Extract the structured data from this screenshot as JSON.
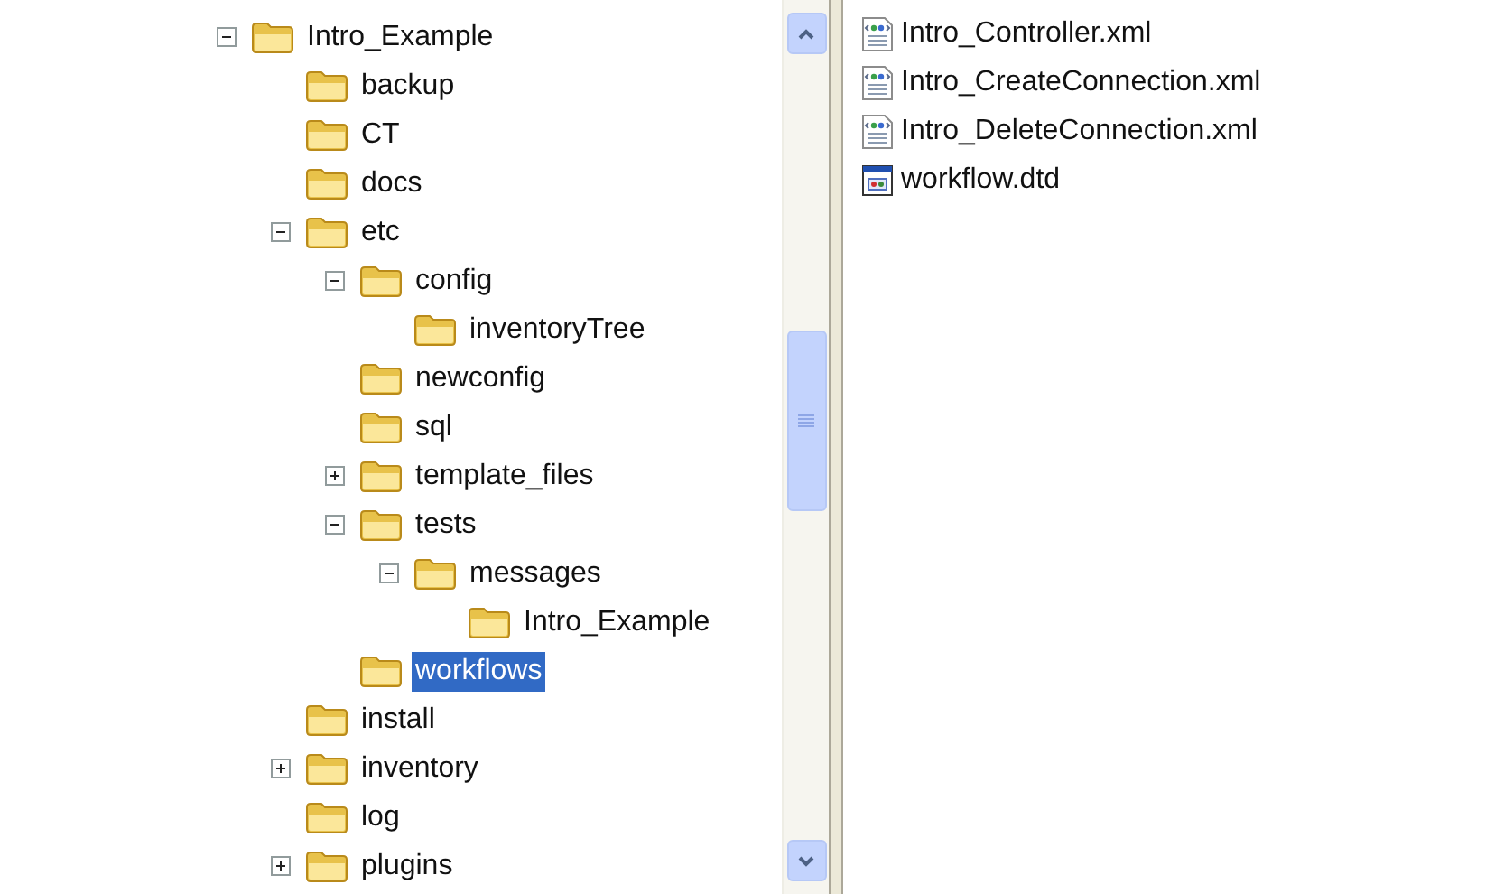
{
  "folder_tree": [
    {
      "label": "Intro_Example",
      "expanded": true,
      "selected": false,
      "children": [
        {
          "label": "backup",
          "selected": false
        },
        {
          "label": "CT",
          "selected": false
        },
        {
          "label": "docs",
          "selected": false
        },
        {
          "label": "etc",
          "expanded": true,
          "selected": false,
          "children": [
            {
              "label": "config",
              "expanded": true,
              "selected": false,
              "children": [
                {
                  "label": "inventoryTree",
                  "selected": false
                }
              ]
            },
            {
              "label": "newconfig",
              "selected": false
            },
            {
              "label": "sql",
              "selected": false
            },
            {
              "label": "template_files",
              "expanded": false,
              "selected": false
            },
            {
              "label": "tests",
              "expanded": true,
              "selected": false,
              "children": [
                {
                  "label": "messages",
                  "expanded": true,
                  "selected": false,
                  "children": [
                    {
                      "label": "Intro_Example",
                      "selected": false
                    }
                  ]
                }
              ]
            },
            {
              "label": "workflows",
              "selected": true
            }
          ]
        },
        {
          "label": "install",
          "selected": false
        },
        {
          "label": "inventory",
          "expanded": false,
          "selected": false
        },
        {
          "label": "log",
          "selected": false
        },
        {
          "label": "plugins",
          "expanded": false,
          "selected": false
        }
      ]
    }
  ],
  "files": [
    {
      "name": "Intro_Controller.xml",
      "kind": "xml"
    },
    {
      "name": "Intro_CreateConnection.xml",
      "kind": "xml"
    },
    {
      "name": "Intro_DeleteConnection.xml",
      "kind": "xml"
    },
    {
      "name": "workflow.dtd",
      "kind": "dtd"
    }
  ]
}
